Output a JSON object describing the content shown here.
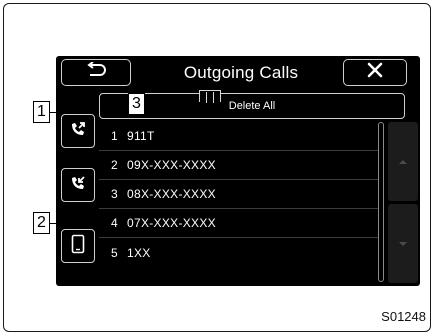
{
  "header": {
    "title": "Outgoing Calls",
    "back_icon": "return-arrow-icon",
    "close_icon": "close-icon"
  },
  "side_buttons": [
    {
      "icon": "outgoing-call-history-icon",
      "callout": "1"
    },
    {
      "icon": "incoming-call-history-icon"
    },
    {
      "icon": "phone-device-icon",
      "callout": "2"
    }
  ],
  "actions": {
    "delete_all_label": "Delete All",
    "callout": "3"
  },
  "calls": [
    {
      "index": "1",
      "number": "911T"
    },
    {
      "index": "2",
      "number": "09X-XXX-XXXX"
    },
    {
      "index": "3",
      "number": "08X-XXX-XXXX"
    },
    {
      "index": "4",
      "number": "07X-XXX-XXXX"
    },
    {
      "index": "5",
      "number": "1XX"
    }
  ],
  "footer": {
    "reference_code": "S01248"
  },
  "colors": {
    "screen_bg": "#000000",
    "text": "#ffffff",
    "button_border": "#cfcfcf",
    "row_divider": "#3b3b3b"
  }
}
